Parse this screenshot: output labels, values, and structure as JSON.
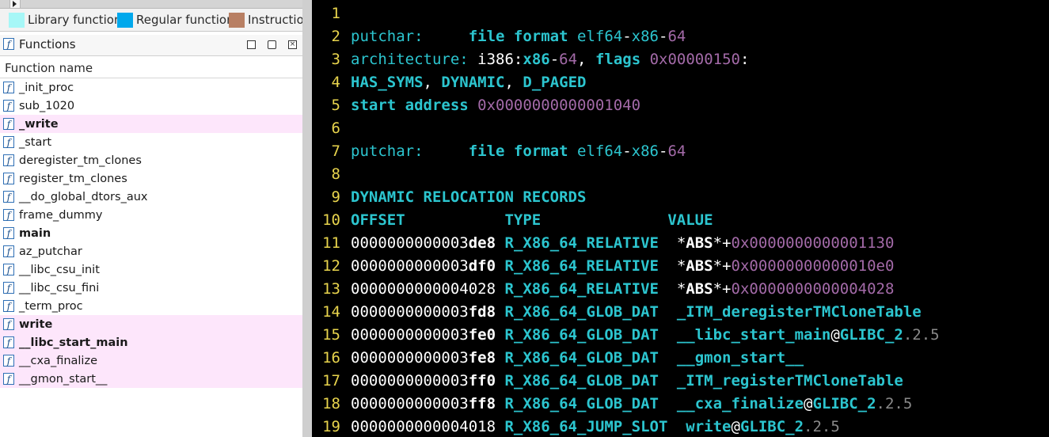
{
  "legend": [
    {
      "label": "Library function",
      "color": "#a6f7f7"
    },
    {
      "label": "Regular function",
      "color": "#00a8ec"
    },
    {
      "label": "Instruction",
      "color": "#b87f63"
    }
  ],
  "functions_panel": {
    "title": "Functions",
    "icon": "function-icon",
    "column_header": "Function name",
    "window_buttons": [
      "maximize",
      "restore",
      "close"
    ],
    "items": [
      {
        "name": "_init_proc",
        "bold": false,
        "highlight": false
      },
      {
        "name": "sub_1020",
        "bold": false,
        "highlight": false
      },
      {
        "name": "_write",
        "bold": true,
        "highlight": true
      },
      {
        "name": "_start",
        "bold": false,
        "highlight": false
      },
      {
        "name": "deregister_tm_clones",
        "bold": false,
        "highlight": false
      },
      {
        "name": "register_tm_clones",
        "bold": false,
        "highlight": false
      },
      {
        "name": "__do_global_dtors_aux",
        "bold": false,
        "highlight": false
      },
      {
        "name": "frame_dummy",
        "bold": false,
        "highlight": false
      },
      {
        "name": "main",
        "bold": true,
        "highlight": false
      },
      {
        "name": "az_putchar",
        "bold": false,
        "highlight": false
      },
      {
        "name": "__libc_csu_init",
        "bold": false,
        "highlight": false
      },
      {
        "name": "__libc_csu_fini",
        "bold": false,
        "highlight": false
      },
      {
        "name": "_term_proc",
        "bold": false,
        "highlight": false
      },
      {
        "name": "write",
        "bold": true,
        "highlight": true
      },
      {
        "name": "__libc_start_main",
        "bold": true,
        "highlight": true
      },
      {
        "name": "__cxa_finalize",
        "bold": false,
        "highlight": true
      },
      {
        "name": "__gmon_start__",
        "bold": false,
        "highlight": true
      }
    ]
  },
  "terminal": {
    "lines": [
      {
        "n": "1",
        "parts": []
      },
      {
        "n": "2",
        "parts": [
          [
            "putchar:     ",
            "c"
          ],
          [
            "file format ",
            "cb"
          ],
          [
            "elf64",
            "c"
          ],
          [
            "-",
            "w"
          ],
          [
            "x86",
            "c"
          ],
          [
            "-",
            "w"
          ],
          [
            "64",
            "m"
          ]
        ]
      },
      {
        "n": "3",
        "parts": [
          [
            "architecture: ",
            "c"
          ],
          [
            "i386",
            "w"
          ],
          [
            ":",
            "w"
          ],
          [
            "x86",
            "cb"
          ],
          [
            "-",
            "w"
          ],
          [
            "64",
            "m"
          ],
          [
            ", ",
            "w"
          ],
          [
            "flags ",
            "cb"
          ],
          [
            "0x00000150",
            "m"
          ],
          [
            ":",
            "w"
          ]
        ]
      },
      {
        "n": "4",
        "parts": [
          [
            "HAS_SYMS",
            "cb"
          ],
          [
            ", ",
            "w"
          ],
          [
            "DYNAMIC",
            "cb"
          ],
          [
            ", ",
            "w"
          ],
          [
            "D_PAGED",
            "cb"
          ]
        ]
      },
      {
        "n": "5",
        "parts": [
          [
            "start address ",
            "cb"
          ],
          [
            "0x0000000000001040",
            "m"
          ]
        ]
      },
      {
        "n": "6",
        "parts": []
      },
      {
        "n": "7",
        "parts": [
          [
            "putchar:     ",
            "c"
          ],
          [
            "file format ",
            "cb"
          ],
          [
            "elf64",
            "c"
          ],
          [
            "-",
            "w"
          ],
          [
            "x86",
            "c"
          ],
          [
            "-",
            "w"
          ],
          [
            "64",
            "m"
          ]
        ]
      },
      {
        "n": "8",
        "parts": []
      },
      {
        "n": "9",
        "parts": [
          [
            "DYNAMIC RELOCATION RECORDS",
            "cb"
          ]
        ]
      },
      {
        "n": "10",
        "parts": [
          [
            "OFFSET           TYPE              VALUE",
            "cb"
          ]
        ]
      },
      {
        "n": "11",
        "parts": [
          [
            "0000000000003",
            "w"
          ],
          [
            "de8",
            "wb"
          ],
          [
            " ",
            "w"
          ],
          [
            "R_X86_64_RELATIVE",
            "cb"
          ],
          [
            "  *",
            "w"
          ],
          [
            "ABS",
            "wb"
          ],
          [
            "*+",
            "w"
          ],
          [
            "0x0000000000001130",
            "m"
          ]
        ]
      },
      {
        "n": "12",
        "parts": [
          [
            "0000000000003",
            "w"
          ],
          [
            "df0",
            "wb"
          ],
          [
            " ",
            "w"
          ],
          [
            "R_X86_64_RELATIVE",
            "cb"
          ],
          [
            "  *",
            "w"
          ],
          [
            "ABS",
            "wb"
          ],
          [
            "*+",
            "w"
          ],
          [
            "0x00000000000010e0",
            "m"
          ]
        ]
      },
      {
        "n": "13",
        "parts": [
          [
            "0000000000004028",
            "w"
          ],
          [
            " ",
            "w"
          ],
          [
            "R_X86_64_RELATIVE",
            "cb"
          ],
          [
            "  *",
            "w"
          ],
          [
            "ABS",
            "wb"
          ],
          [
            "*+",
            "w"
          ],
          [
            "0x0000000000004028",
            "m"
          ]
        ]
      },
      {
        "n": "14",
        "parts": [
          [
            "0000000000003",
            "w"
          ],
          [
            "fd8",
            "wb"
          ],
          [
            " ",
            "w"
          ],
          [
            "R_X86_64_GLOB_DAT",
            "cb"
          ],
          [
            "  ",
            "w"
          ],
          [
            "_ITM_deregisterTMCloneTable",
            "cb"
          ]
        ]
      },
      {
        "n": "15",
        "parts": [
          [
            "0000000000003",
            "w"
          ],
          [
            "fe0",
            "wb"
          ],
          [
            " ",
            "w"
          ],
          [
            "R_X86_64_GLOB_DAT",
            "cb"
          ],
          [
            "  ",
            "w"
          ],
          [
            "__libc_start_main",
            "cb"
          ],
          [
            "@",
            "w"
          ],
          [
            "GLIBC_2",
            "cb"
          ],
          [
            ".2.5",
            "g"
          ]
        ]
      },
      {
        "n": "16",
        "parts": [
          [
            "0000000000003",
            "w"
          ],
          [
            "fe8",
            "wb"
          ],
          [
            " ",
            "w"
          ],
          [
            "R_X86_64_GLOB_DAT",
            "cb"
          ],
          [
            "  ",
            "w"
          ],
          [
            "__gmon_start__",
            "cb"
          ]
        ]
      },
      {
        "n": "17",
        "parts": [
          [
            "0000000000003",
            "w"
          ],
          [
            "ff0",
            "wb"
          ],
          [
            " ",
            "w"
          ],
          [
            "R_X86_64_GLOB_DAT",
            "cb"
          ],
          [
            "  ",
            "w"
          ],
          [
            "_ITM_registerTMCloneTable",
            "cb"
          ]
        ]
      },
      {
        "n": "18",
        "parts": [
          [
            "0000000000003",
            "w"
          ],
          [
            "ff8",
            "wb"
          ],
          [
            " ",
            "w"
          ],
          [
            "R_X86_64_GLOB_DAT",
            "cb"
          ],
          [
            "  ",
            "w"
          ],
          [
            "__cxa_finalize",
            "cb"
          ],
          [
            "@",
            "w"
          ],
          [
            "GLIBC_2",
            "cb"
          ],
          [
            ".2.5",
            "g"
          ]
        ]
      },
      {
        "n": "19",
        "parts": [
          [
            "0000000000004018",
            "w"
          ],
          [
            " ",
            "w"
          ],
          [
            "R_X86_64_JUMP_SLOT",
            "cb"
          ],
          [
            "  ",
            "w"
          ],
          [
            "write",
            "cb"
          ],
          [
            "@",
            "w"
          ],
          [
            "GLIBC_2",
            "cb"
          ],
          [
            ".2.5",
            "g"
          ]
        ]
      }
    ]
  }
}
